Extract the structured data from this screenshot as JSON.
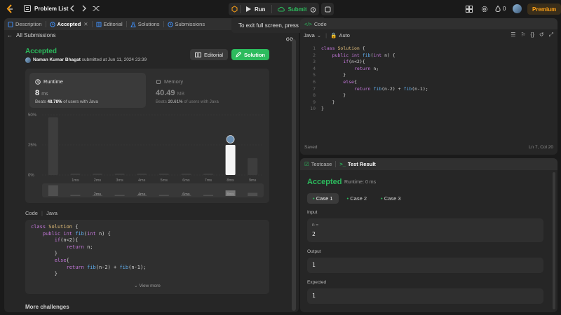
{
  "topbar": {
    "problem_list": "Problem List",
    "run": "Run",
    "submit": "Submit",
    "streak": "0",
    "premium": "Premium"
  },
  "tooltip": {
    "text": "To exit full screen, press",
    "key": "Esc"
  },
  "left_tabs": {
    "description": "Description",
    "accepted": "Accepted",
    "editorial": "Editorial",
    "solutions": "Solutions",
    "submissions": "Submissions"
  },
  "submission": {
    "back": "All Submissions",
    "status": "Accepted",
    "user": "Naman Kumar Bhagat",
    "submitted": "submitted at Jun 11, 2024 23:39",
    "editorial_btn": "Editorial",
    "solution_btn": "Solution",
    "runtime_label": "Runtime",
    "runtime_value": "8",
    "runtime_unit": "ms",
    "runtime_beats_pre": "Beats",
    "runtime_beats": "48.78%",
    "runtime_beats_post": "of users with Java",
    "memory_label": "Memory",
    "memory_value": "40.49",
    "memory_unit": "MB",
    "memory_beats_pre": "Beats",
    "memory_beats": "20.61%",
    "memory_beats_post": "of users with Java",
    "code_label": "Code",
    "code_lang": "Java",
    "view_more": "View more",
    "more_challenges": "More challenges"
  },
  "chart_data": {
    "type": "bar",
    "categories": [
      "",
      "1ms",
      "2ms",
      "3ms",
      "4ms",
      "5ms",
      "6ms",
      "7ms",
      "8ms",
      "9ms"
    ],
    "values": [
      48,
      1,
      1,
      1,
      1,
      1,
      1,
      1,
      25,
      14
    ],
    "ytick_labels": [
      "50%",
      "25%",
      "0%"
    ],
    "highlight_index": 8,
    "mini_labels": [
      "2ms",
      "4ms",
      "6ms",
      "8ms"
    ],
    "ylim": [
      0,
      50
    ]
  },
  "left_code": [
    "class Solution {",
    "    public int fib(int n) {",
    "        if(n<2){",
    "            return n;",
    "        }",
    "        else{",
    "            return fib(n-2) + fib(n-1);",
    "        }"
  ],
  "editor": {
    "lang": "Java",
    "auto": "Auto",
    "tab_label": "Code",
    "status_left": "Saved",
    "status_right": "Ln 7, Col 20",
    "lines": [
      "class Solution {",
      "    public int fib(int n) {",
      "        if(n<2){",
      "            return n;",
      "        }",
      "        else{",
      "            return fib(n-2) + fib(n-1);",
      "        }",
      "    }",
      "}"
    ],
    "line_numbers": [
      "1",
      "2",
      "3",
      "4",
      "5",
      "6",
      "7",
      "8",
      "9",
      "10"
    ]
  },
  "result": {
    "testcase_tab": "Testcase",
    "result_tab": "Test Result",
    "status": "Accepted",
    "runtime": "Runtime: 0 ms",
    "cases": [
      "Case 1",
      "Case 2",
      "Case 3"
    ],
    "input_label": "Input",
    "input_var": "n =",
    "input_value": "2",
    "output_label": "Output",
    "output_value": "1",
    "expected_label": "Expected",
    "expected_value": "1"
  },
  "colors": {
    "accent_green": "#2cbb5d",
    "bg": "#1a1a1a",
    "panel": "#262626",
    "premium": "#ffa116"
  }
}
